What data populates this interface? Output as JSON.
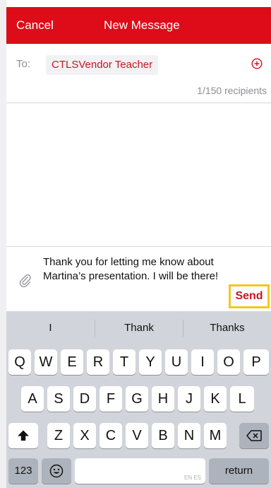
{
  "header": {
    "cancel_label": "Cancel",
    "title": "New Message"
  },
  "recipients": {
    "to_label": "To:",
    "chips": [
      "CTLSVendor Teacher"
    ],
    "count": "1/150 recipients",
    "add_icon": "plus-circle-icon"
  },
  "compose": {
    "message": "Thank you for letting me know about Martina’s presentation. I will be there!",
    "attach_icon": "paperclip-icon",
    "send_label": "Send"
  },
  "keyboard": {
    "suggestions": [
      "I",
      "Thank",
      "Thanks"
    ],
    "row1": [
      "Q",
      "W",
      "E",
      "R",
      "T",
      "Y",
      "U",
      "I",
      "O",
      "P"
    ],
    "row2": [
      "A",
      "S",
      "D",
      "F",
      "G",
      "H",
      "J",
      "K",
      "L"
    ],
    "row3": [
      "Z",
      "X",
      "C",
      "V",
      "B",
      "N",
      "M"
    ],
    "numbers_label": "123",
    "space_lang": "EN ES",
    "return_label": "return",
    "shift_icon": "shift-icon",
    "delete_icon": "backspace-icon",
    "emoji_icon": "emoji-icon"
  },
  "colors": {
    "brand": "#dd0c18",
    "highlight": "#f3c81d"
  }
}
